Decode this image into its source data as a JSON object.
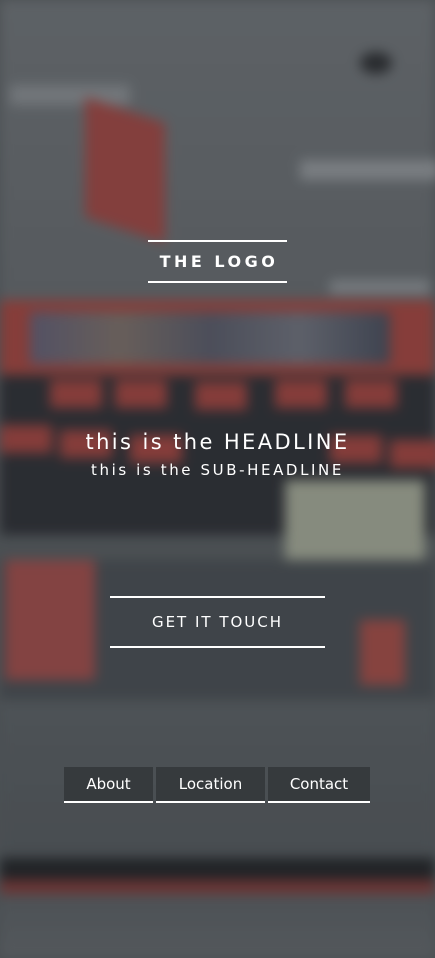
{
  "hero": {
    "logo": "THE LOGO",
    "headline": "this is the HEADLINE",
    "subheadline": "this is the SUB-HEADLINE",
    "cta_label": "GET IT TOUCH"
  },
  "nav": {
    "items": [
      {
        "label": "About"
      },
      {
        "label": "Location"
      },
      {
        "label": "Contact"
      }
    ]
  },
  "colors": {
    "text": "#ffffff",
    "nav_background": "#32363a",
    "overlay": "#282c30"
  },
  "icons": {}
}
